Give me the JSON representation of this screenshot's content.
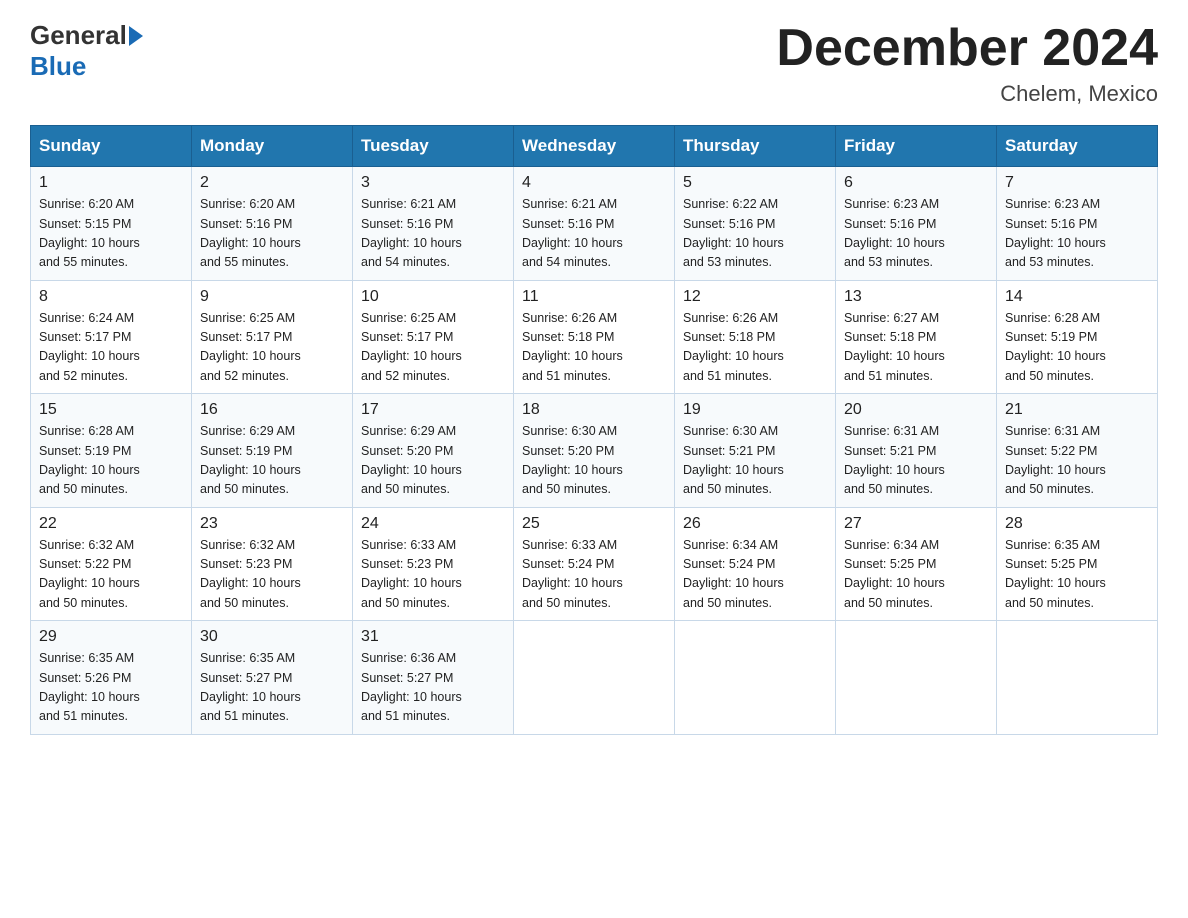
{
  "header": {
    "logo_general": "General",
    "logo_blue": "Blue",
    "title": "December 2024",
    "location": "Chelem, Mexico"
  },
  "days_of_week": [
    "Sunday",
    "Monday",
    "Tuesday",
    "Wednesday",
    "Thursday",
    "Friday",
    "Saturday"
  ],
  "weeks": [
    [
      {
        "day": "1",
        "sunrise": "6:20 AM",
        "sunset": "5:15 PM",
        "daylight": "10 hours and 55 minutes."
      },
      {
        "day": "2",
        "sunrise": "6:20 AM",
        "sunset": "5:16 PM",
        "daylight": "10 hours and 55 minutes."
      },
      {
        "day": "3",
        "sunrise": "6:21 AM",
        "sunset": "5:16 PM",
        "daylight": "10 hours and 54 minutes."
      },
      {
        "day": "4",
        "sunrise": "6:21 AM",
        "sunset": "5:16 PM",
        "daylight": "10 hours and 54 minutes."
      },
      {
        "day": "5",
        "sunrise": "6:22 AM",
        "sunset": "5:16 PM",
        "daylight": "10 hours and 53 minutes."
      },
      {
        "day": "6",
        "sunrise": "6:23 AM",
        "sunset": "5:16 PM",
        "daylight": "10 hours and 53 minutes."
      },
      {
        "day": "7",
        "sunrise": "6:23 AM",
        "sunset": "5:16 PM",
        "daylight": "10 hours and 53 minutes."
      }
    ],
    [
      {
        "day": "8",
        "sunrise": "6:24 AM",
        "sunset": "5:17 PM",
        "daylight": "10 hours and 52 minutes."
      },
      {
        "day": "9",
        "sunrise": "6:25 AM",
        "sunset": "5:17 PM",
        "daylight": "10 hours and 52 minutes."
      },
      {
        "day": "10",
        "sunrise": "6:25 AM",
        "sunset": "5:17 PM",
        "daylight": "10 hours and 52 minutes."
      },
      {
        "day": "11",
        "sunrise": "6:26 AM",
        "sunset": "5:18 PM",
        "daylight": "10 hours and 51 minutes."
      },
      {
        "day": "12",
        "sunrise": "6:26 AM",
        "sunset": "5:18 PM",
        "daylight": "10 hours and 51 minutes."
      },
      {
        "day": "13",
        "sunrise": "6:27 AM",
        "sunset": "5:18 PM",
        "daylight": "10 hours and 51 minutes."
      },
      {
        "day": "14",
        "sunrise": "6:28 AM",
        "sunset": "5:19 PM",
        "daylight": "10 hours and 50 minutes."
      }
    ],
    [
      {
        "day": "15",
        "sunrise": "6:28 AM",
        "sunset": "5:19 PM",
        "daylight": "10 hours and 50 minutes."
      },
      {
        "day": "16",
        "sunrise": "6:29 AM",
        "sunset": "5:19 PM",
        "daylight": "10 hours and 50 minutes."
      },
      {
        "day": "17",
        "sunrise": "6:29 AM",
        "sunset": "5:20 PM",
        "daylight": "10 hours and 50 minutes."
      },
      {
        "day": "18",
        "sunrise": "6:30 AM",
        "sunset": "5:20 PM",
        "daylight": "10 hours and 50 minutes."
      },
      {
        "day": "19",
        "sunrise": "6:30 AM",
        "sunset": "5:21 PM",
        "daylight": "10 hours and 50 minutes."
      },
      {
        "day": "20",
        "sunrise": "6:31 AM",
        "sunset": "5:21 PM",
        "daylight": "10 hours and 50 minutes."
      },
      {
        "day": "21",
        "sunrise": "6:31 AM",
        "sunset": "5:22 PM",
        "daylight": "10 hours and 50 minutes."
      }
    ],
    [
      {
        "day": "22",
        "sunrise": "6:32 AM",
        "sunset": "5:22 PM",
        "daylight": "10 hours and 50 minutes."
      },
      {
        "day": "23",
        "sunrise": "6:32 AM",
        "sunset": "5:23 PM",
        "daylight": "10 hours and 50 minutes."
      },
      {
        "day": "24",
        "sunrise": "6:33 AM",
        "sunset": "5:23 PM",
        "daylight": "10 hours and 50 minutes."
      },
      {
        "day": "25",
        "sunrise": "6:33 AM",
        "sunset": "5:24 PM",
        "daylight": "10 hours and 50 minutes."
      },
      {
        "day": "26",
        "sunrise": "6:34 AM",
        "sunset": "5:24 PM",
        "daylight": "10 hours and 50 minutes."
      },
      {
        "day": "27",
        "sunrise": "6:34 AM",
        "sunset": "5:25 PM",
        "daylight": "10 hours and 50 minutes."
      },
      {
        "day": "28",
        "sunrise": "6:35 AM",
        "sunset": "5:25 PM",
        "daylight": "10 hours and 50 minutes."
      }
    ],
    [
      {
        "day": "29",
        "sunrise": "6:35 AM",
        "sunset": "5:26 PM",
        "daylight": "10 hours and 51 minutes."
      },
      {
        "day": "30",
        "sunrise": "6:35 AM",
        "sunset": "5:27 PM",
        "daylight": "10 hours and 51 minutes."
      },
      {
        "day": "31",
        "sunrise": "6:36 AM",
        "sunset": "5:27 PM",
        "daylight": "10 hours and 51 minutes."
      },
      null,
      null,
      null,
      null
    ]
  ],
  "labels": {
    "sunrise": "Sunrise:",
    "sunset": "Sunset:",
    "daylight": "Daylight:"
  }
}
